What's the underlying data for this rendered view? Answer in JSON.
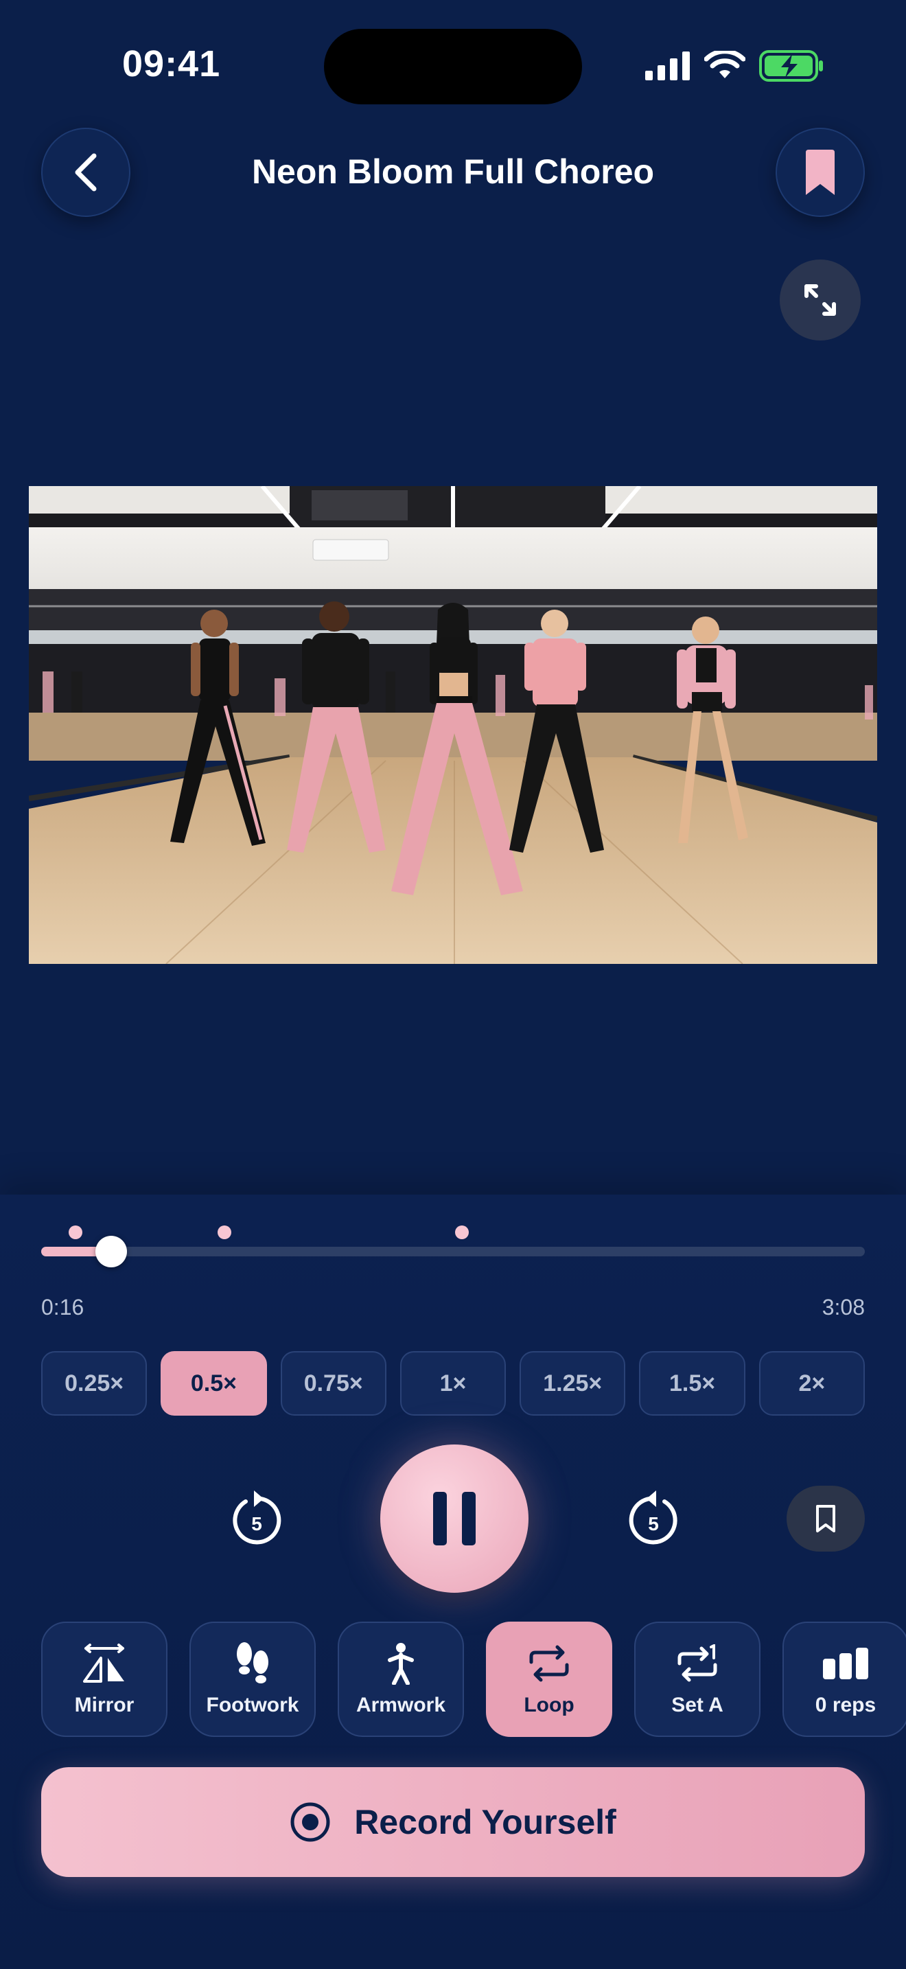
{
  "status_bar": {
    "time": "09:41"
  },
  "header": {
    "title": "Neon Bloom Full Choreo"
  },
  "player": {
    "current_time": "0:16",
    "total_time": "3:08",
    "progress": 0.085
  },
  "speeds": {
    "options": [
      "0.25×",
      "0.5×",
      "0.75×",
      "1×",
      "1.25×",
      "1.5×",
      "2×"
    ],
    "selected": "0.5×"
  },
  "controls": {
    "skip_seconds": "5"
  },
  "tools": [
    {
      "label": "Mirror",
      "icon": "mirror-icon",
      "active": false
    },
    {
      "label": "Footwork",
      "icon": "footprints-icon",
      "active": false
    },
    {
      "label": "Armwork",
      "icon": "person-icon",
      "active": false
    },
    {
      "label": "Loop",
      "icon": "loop-icon",
      "active": true
    },
    {
      "label": "Set A",
      "icon": "set-a-icon",
      "active": false
    },
    {
      "label": "0 reps",
      "icon": "bar-chart-icon",
      "active": false
    }
  ],
  "record": {
    "label": "Record Yourself"
  },
  "colors": {
    "background": "#0b1f4a",
    "accent": "#e8a1b5",
    "chip": "#13295a",
    "battery": "#4cd964"
  }
}
